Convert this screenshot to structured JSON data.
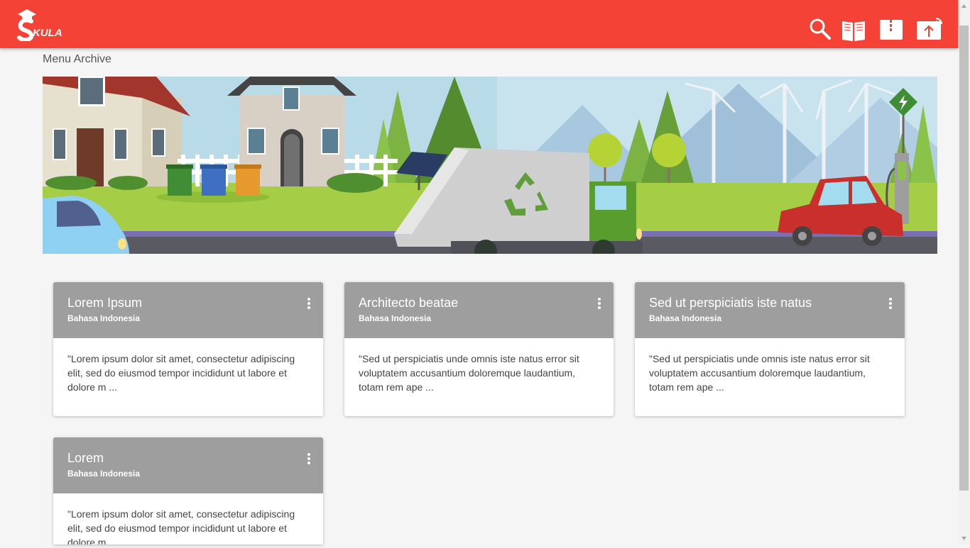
{
  "app": {
    "logo_text": "SKULA"
  },
  "toolbar": {
    "icons": [
      "search-icon",
      "book-icon",
      "archive-icon",
      "upload-cloud-icon"
    ],
    "accent": "#f44336"
  },
  "page": {
    "title": "Menu Archive"
  },
  "cards": [
    {
      "title": "Lorem Ipsum",
      "subtitle": "Bahasa Indonesia",
      "text": "\"Lorem ipsum dolor sit amet, consectetur adipiscing elit, sed do eiusmod tempor incididunt ut labore et dolore m ..."
    },
    {
      "title": "Architecto beatae",
      "subtitle": "Bahasa Indonesia",
      "text": "\"Sed ut perspiciatis unde omnis iste natus error sit voluptatem accusantium doloremque laudantium, totam rem ape ..."
    },
    {
      "title": "Sed ut perspiciatis iste natus",
      "subtitle": "Bahasa Indonesia",
      "text": "\"Sed ut perspiciatis unde omnis iste natus error sit voluptatem accusantium doloremque laudantium, totam rem ape ..."
    },
    {
      "title": "Lorem",
      "subtitle": "Bahasa Indonesia",
      "text": "\"Lorem ipsum dolor sit amet, consectetur adipiscing elit, sed do eiusmod tempor incididunt ut labore et dolore m ..."
    }
  ]
}
